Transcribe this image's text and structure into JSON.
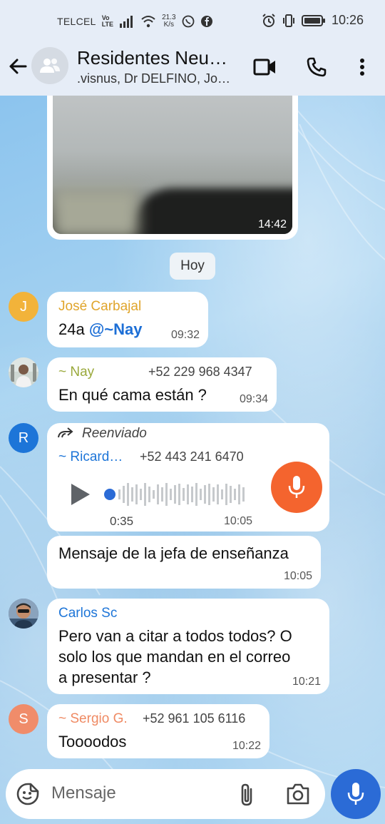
{
  "status_bar": {
    "carrier": "TELCEL",
    "volte_top": "Vo",
    "volte_bottom": "LTE",
    "speed_value": "21.3",
    "speed_unit": "K/s",
    "time": "10:26"
  },
  "header": {
    "title": "Residentes Neu…",
    "subtitle": ".visnus, Dr DELFINO, Jo…",
    "icons": [
      "back-arrow-icon",
      "video-call-icon",
      "phone-icon",
      "more-vert-icon"
    ]
  },
  "media_message": {
    "time": "14:42"
  },
  "date_separator": "Hoy",
  "messages": [
    {
      "avatar_letter": "J",
      "avatar_color": "#f2b33a",
      "sender": "José Carbajal",
      "sender_color": "#e0a52c",
      "text_main": "24a ",
      "mention": "@~Nay",
      "time": "09:32"
    },
    {
      "sender": "~ Nay",
      "sender_color": "#9aa93c",
      "phone": "+52 229 968 4347",
      "text": "En qué cama están ?",
      "time": "09:34"
    },
    {
      "avatar_letter": "R",
      "avatar_color": "#1d75d8",
      "forwarded_label": "Reenviado",
      "sender": "~ Ricard…",
      "sender_color": "#1d75d8",
      "phone": "+52 443 241 6470",
      "duration": "0:35",
      "time": "10:05"
    },
    {
      "text": "Mensaje de la jefa de enseñanza",
      "time": "10:05"
    },
    {
      "sender": "Carlos Sc",
      "sender_color": "#1d75d8",
      "text_lines": [
        "Pero van a citar a todos todos? O",
        "solo los que mandan en el correo",
        "a presentar ?"
      ],
      "time": "10:21"
    },
    {
      "avatar_letter": "S",
      "avatar_color": "#f08c6a",
      "sender": "~ Sergio G.",
      "sender_color": "#ef8a63",
      "phone": "+52 961 105 6116",
      "text": "Toooodos",
      "time": "10:22"
    }
  ],
  "input": {
    "placeholder": "Mensaje"
  },
  "colors": {
    "accent_blue": "#2b6bd6",
    "voice_orange": "#f4642e",
    "header_bg": "#e6edf7"
  }
}
